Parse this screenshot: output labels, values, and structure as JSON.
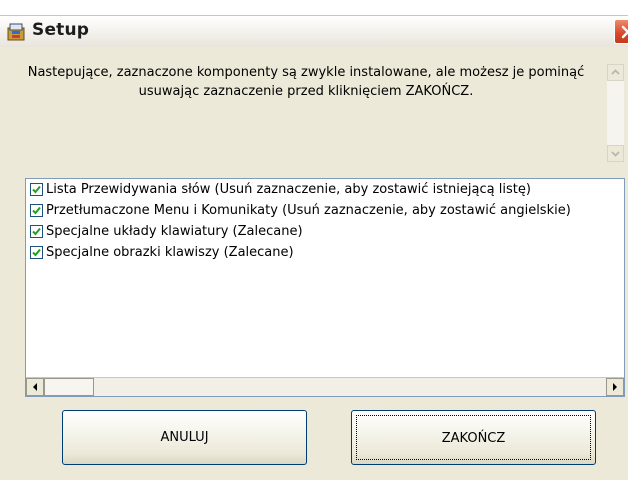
{
  "window": {
    "title": "Setup",
    "icon": "setup-installer-icon",
    "close_icon": "close-icon"
  },
  "message": {
    "line1": "Nastepujące, zaznaczone komponenty są zwykle instalowane, ale możesz je pominąć",
    "line2": "usuwając zaznaczenie przed kliknięciem ZAKOŃCZ."
  },
  "components": [
    {
      "label": "Lista Przewidywania słów (Usuń zaznaczenie, aby zostawić istniejącą listę)",
      "checked": true
    },
    {
      "label": "Przetłumaczone Menu i Komunikaty (Usuń zaznaczenie, aby zostawić angielskie)",
      "checked": true
    },
    {
      "label": "Specjalne układy klawiatury (Zalecane)",
      "checked": true
    },
    {
      "label": "Specjalne obrazki klawiszy (Zalecane)",
      "checked": true
    }
  ],
  "buttons": {
    "cancel": "ANULUJ",
    "finish": "ZAKOŃCZ"
  },
  "colors": {
    "dialog_bg": "#ece9d8",
    "close_button": "#d7482a",
    "checkbox_border": "#1c5180",
    "button_border": "#003c74"
  }
}
